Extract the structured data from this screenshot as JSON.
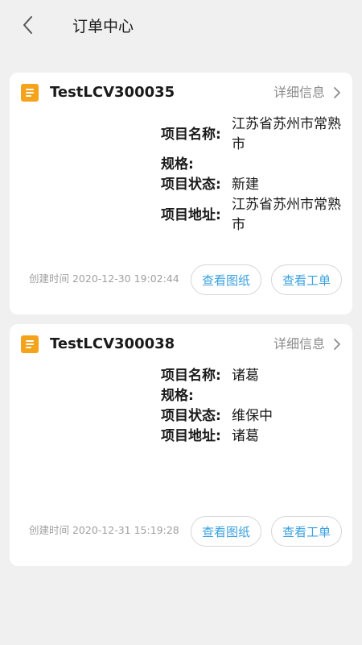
{
  "header": {
    "title": "订单中心"
  },
  "orders": [
    {
      "id": "TestLCV300035",
      "detail_label": "详细信息",
      "fields": [
        {
          "label": "项目名称:",
          "value": "江苏省苏州市常熟市"
        },
        {
          "label": "规格:",
          "value": ""
        },
        {
          "label": "项目状态:",
          "value": "新建"
        },
        {
          "label": "项目地址:",
          "value": "江苏省苏州市常熟市"
        }
      ],
      "created": "创建时间 2020-12-30 19:02:44",
      "view_drawing_label": "查看图纸",
      "view_workorder_label": "查看工单"
    },
    {
      "id": "TestLCV300038",
      "detail_label": "详细信息",
      "fields": [
        {
          "label": "项目名称:",
          "value": "诸葛"
        },
        {
          "label": "规格:",
          "value": ""
        },
        {
          "label": "项目状态:",
          "value": "维保中"
        },
        {
          "label": "项目地址:",
          "value": "诸葛"
        }
      ],
      "created": "创建时间 2020-12-31 15:19:28",
      "view_drawing_label": "查看图纸",
      "view_workorder_label": "查看工单"
    }
  ],
  "icons": {
    "back": "chevron-left-icon",
    "order": "document-list-icon",
    "detail": "chevron-right-icon"
  },
  "colors": {
    "accent": "#3aa1e0",
    "order_icon": "#f5a31a",
    "background": "#f0f0f0"
  }
}
